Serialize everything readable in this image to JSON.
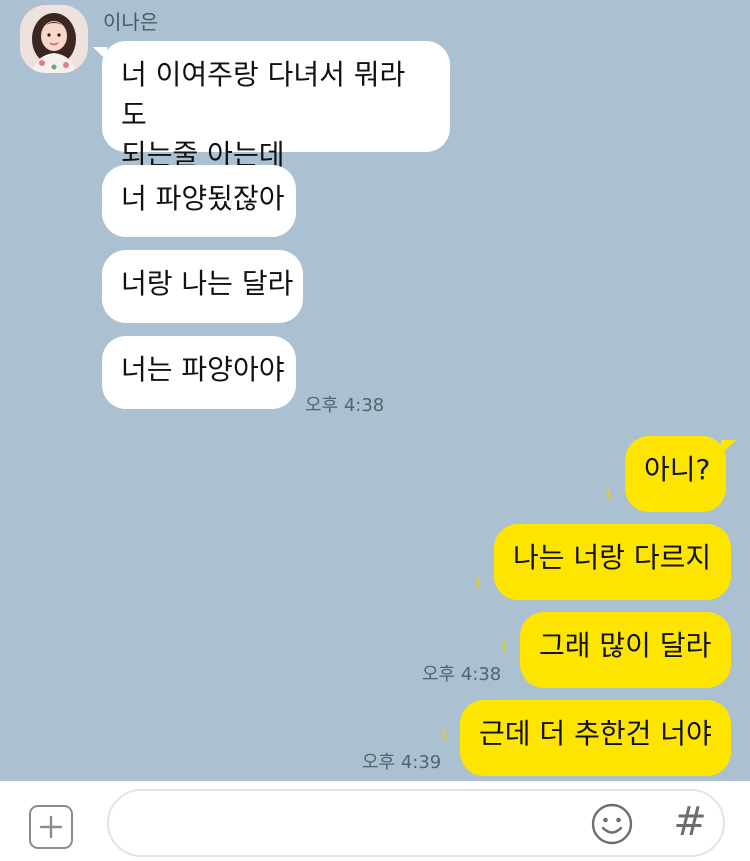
{
  "chat": {
    "sender_name": "이나은",
    "incoming": [
      {
        "text": "너 이여주랑 다녀서 뭐라도\n되는줄 아는데"
      },
      {
        "text": "너 파양됬잖아"
      },
      {
        "text": "너랑 나는 달라"
      },
      {
        "text": "너는 파양아야",
        "time": "오후 4:38"
      }
    ],
    "outgoing": [
      {
        "text": "아니?",
        "unread": "1"
      },
      {
        "text": "나는 너랑 다르지",
        "unread": "1"
      },
      {
        "text": "그래 많이 달라",
        "unread": "1",
        "time": "오후 4:38"
      },
      {
        "text": "근데 더 추한건 너야",
        "unread": "1",
        "time": "오후 4:39"
      }
    ]
  },
  "input_bar": {
    "message_value": "",
    "add_icon": "plus-icon",
    "emoji_icon": "smiley-icon",
    "hash_label": "#"
  },
  "colors": {
    "background": "#abc1d1",
    "incoming_bubble": "#ffffff",
    "outgoing_bubble": "#fee500",
    "unread_count": "#e7d300"
  }
}
